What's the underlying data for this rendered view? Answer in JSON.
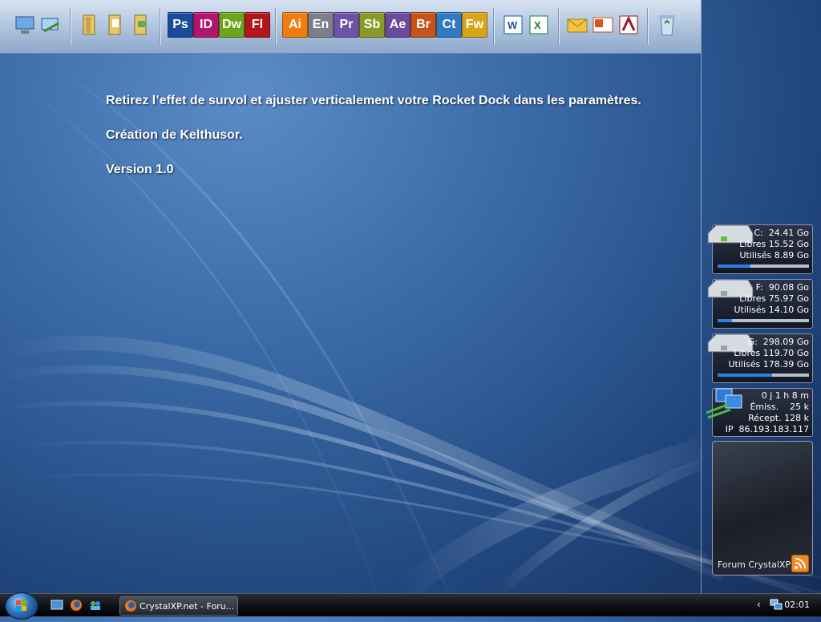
{
  "dock": {
    "system_icons": [
      "computer-icon",
      "network-places-icon"
    ],
    "folder_icons": [
      "folder-icon",
      "folder-documents-icon",
      "folder-pictures-icon"
    ],
    "adobe_apps_1": [
      {
        "abbr": "Ps",
        "color": "#1b4c9c"
      },
      {
        "abbr": "ID",
        "color": "#b0166e"
      },
      {
        "abbr": "Dw",
        "color": "#6aa51e"
      },
      {
        "abbr": "Fl",
        "color": "#b3161b"
      }
    ],
    "adobe_apps_2": [
      {
        "abbr": "Ai",
        "color": "#f07c10"
      },
      {
        "abbr": "En",
        "color": "#7b7f8a"
      },
      {
        "abbr": "Pr",
        "color": "#6f52a8"
      },
      {
        "abbr": "Sb",
        "color": "#8a9a28"
      },
      {
        "abbr": "Ae",
        "color": "#6a4a9a"
      },
      {
        "abbr": "Br",
        "color": "#c4541a"
      },
      {
        "abbr": "Ct",
        "color": "#2f7ac0"
      },
      {
        "abbr": "Fw",
        "color": "#d8a41a"
      }
    ],
    "office_icons": [
      "word-icon",
      "excel-icon"
    ],
    "office_icons_2": [
      "outlook-icon",
      "powerpoint-icon",
      "access-icon"
    ],
    "recycle_icon": "recycle-bin-icon"
  },
  "desktop_text": {
    "line1": "Retirez l’effet de survol et ajuster verticalement votre Rocket Dock dans les paramètres.",
    "line2": "Création de Kelthusor.",
    "line3": "Version 1.0"
  },
  "drives": [
    {
      "letter": "C:",
      "total": "24.41 Go",
      "free_label": "Libres",
      "free": "15.52 Go",
      "used_label": "Utilisés",
      "used": "8.89 Go",
      "used_fraction": 0.36
    },
    {
      "letter": "F:",
      "total": "90.08 Go",
      "free_label": "Libres",
      "free": "75.97 Go",
      "used_label": "Utilisés",
      "used": "14.10 Go",
      "used_fraction": 0.16
    },
    {
      "letter": "G:",
      "total": "298.09 Go",
      "free_label": "Libres",
      "free": "119.70 Go",
      "used_label": "Utilisés",
      "used": "178.39 Go",
      "used_fraction": 0.6
    }
  ],
  "network": {
    "uptime": "0 j 1 h 8 m",
    "sent_label": "Émiss.",
    "sent": "25 k",
    "recv_label": "Récept.",
    "recv": "128 k",
    "ip_label": "IP",
    "ip": "86.193.183.117"
  },
  "forum": {
    "label": "Forum CrystalXP"
  },
  "taskbar": {
    "task_label": "CrystalXP.net - Foru...",
    "clock": "02:01",
    "tray_chevron": "‹"
  }
}
